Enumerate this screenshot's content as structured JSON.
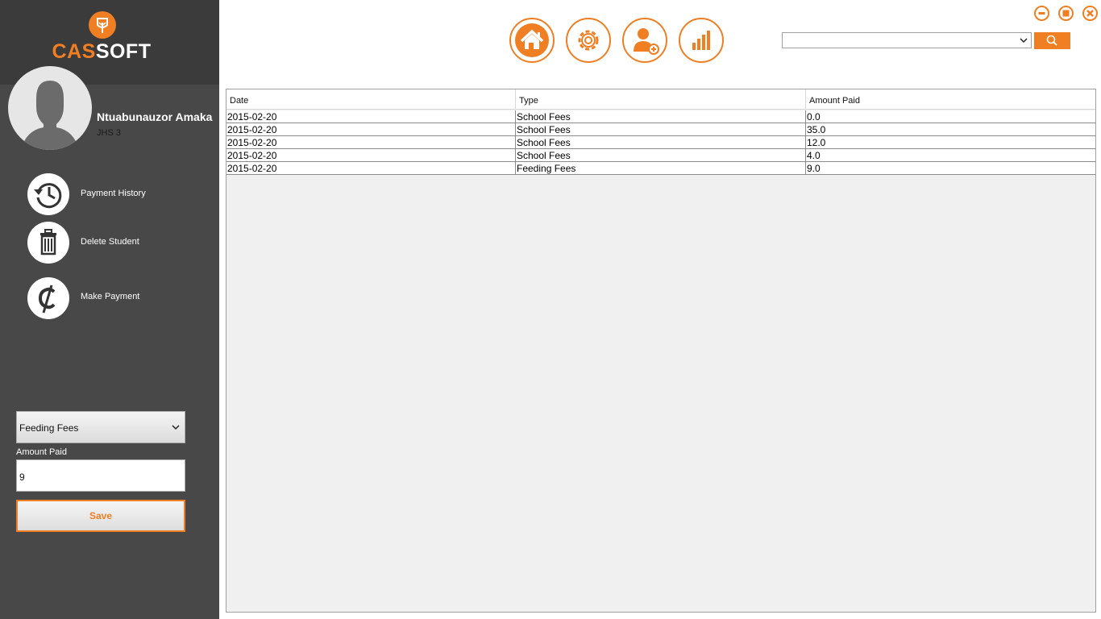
{
  "app": {
    "logo_part1": "CAS",
    "logo_part2": "SOFT",
    "accent_color": "#f07f24"
  },
  "student": {
    "name": "Ntuabunauzor Amaka",
    "class": "JHS 3"
  },
  "actions": [
    {
      "label": "Payment History",
      "icon": "history-icon"
    },
    {
      "label": "Delete Student",
      "icon": "trash-icon"
    },
    {
      "label": "Make Payment",
      "icon": "cedi-icon"
    }
  ],
  "payment_form": {
    "fee_type": "Feeding Fees",
    "amount_label": "Amount Paid",
    "amount_value": "9",
    "save_label": "Save"
  },
  "top_nav": [
    "home-icon",
    "settings-icon",
    "add-user-icon",
    "chart-icon"
  ],
  "window_controls": [
    "minimize-icon",
    "maximize-icon",
    "close-icon"
  ],
  "table": {
    "columns": [
      "Date",
      "Type",
      "Amount Paid"
    ],
    "rows": [
      [
        "2015-02-20",
        "School Fees",
        "0.0"
      ],
      [
        "2015-02-20",
        "School Fees",
        "35.0"
      ],
      [
        "2015-02-20",
        "School Fees",
        "12.0"
      ],
      [
        "2015-02-20",
        "School Fees",
        "4.0"
      ],
      [
        "2015-02-20",
        "Feeding Fees",
        "9.0"
      ]
    ]
  }
}
